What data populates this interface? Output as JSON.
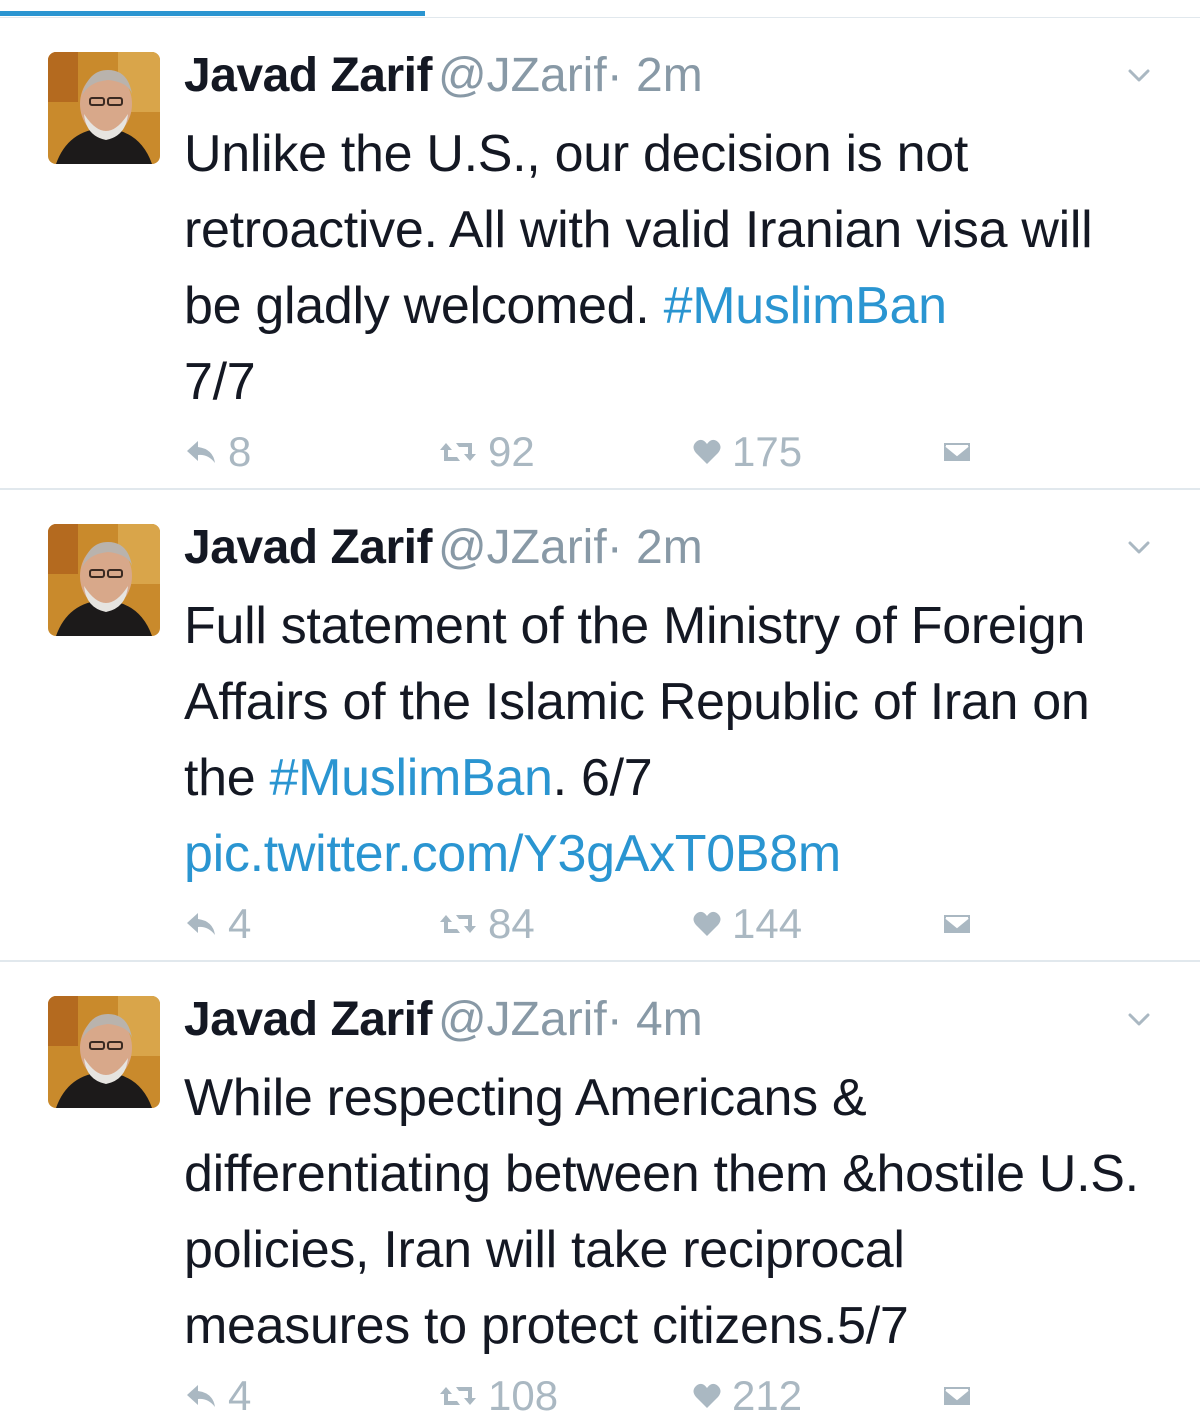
{
  "colors": {
    "link": "#2a95d1",
    "name": "#141823",
    "muted": "#8899a6",
    "action_icon": "#aab8c2",
    "divider": "#e1e8ed"
  },
  "tweets": [
    {
      "name": "Javad Zarif",
      "handle": "@JZarif",
      "dot": "·",
      "time": "2m",
      "text_parts": {
        "a": "Unlike the U.S., our decision is not retroactive.  All with valid Iranian visa will be gladly welcomed. ",
        "hashtag": "#MuslimBan",
        "b": " 7/7"
      },
      "replies": "8",
      "retweets": "92",
      "likes": "175",
      "icons": [
        "reply-icon",
        "retweet-icon",
        "heart-icon",
        "direct-message-icon",
        "chevron-down-icon"
      ]
    },
    {
      "name": "Javad Zarif",
      "handle": "@JZarif",
      "dot": "·",
      "time": "2m",
      "text_parts": {
        "a": "Full statement of the Ministry of Foreign Affairs of the Islamic Republic of Iran on the ",
        "hashtag": "#MuslimBan",
        "b": ". 6/7 ",
        "link": "pic.twitter.com/Y3gAxT0B8m"
      },
      "replies": "4",
      "retweets": "84",
      "likes": "144",
      "icons": [
        "reply-icon",
        "retweet-icon",
        "heart-icon",
        "direct-message-icon",
        "chevron-down-icon"
      ]
    },
    {
      "name": "Javad Zarif",
      "handle": "@JZarif",
      "dot": "·",
      "time": "4m",
      "text_parts": {
        "a": "While respecting Americans & differentiating between them &hostile U.S. policies, Iran will take reciprocal measures to protect citizens.5/7"
      },
      "replies": "4",
      "retweets": "108",
      "likes": "212",
      "icons": [
        "reply-icon",
        "retweet-icon",
        "heart-icon",
        "direct-message-icon",
        "chevron-down-icon"
      ]
    }
  ]
}
